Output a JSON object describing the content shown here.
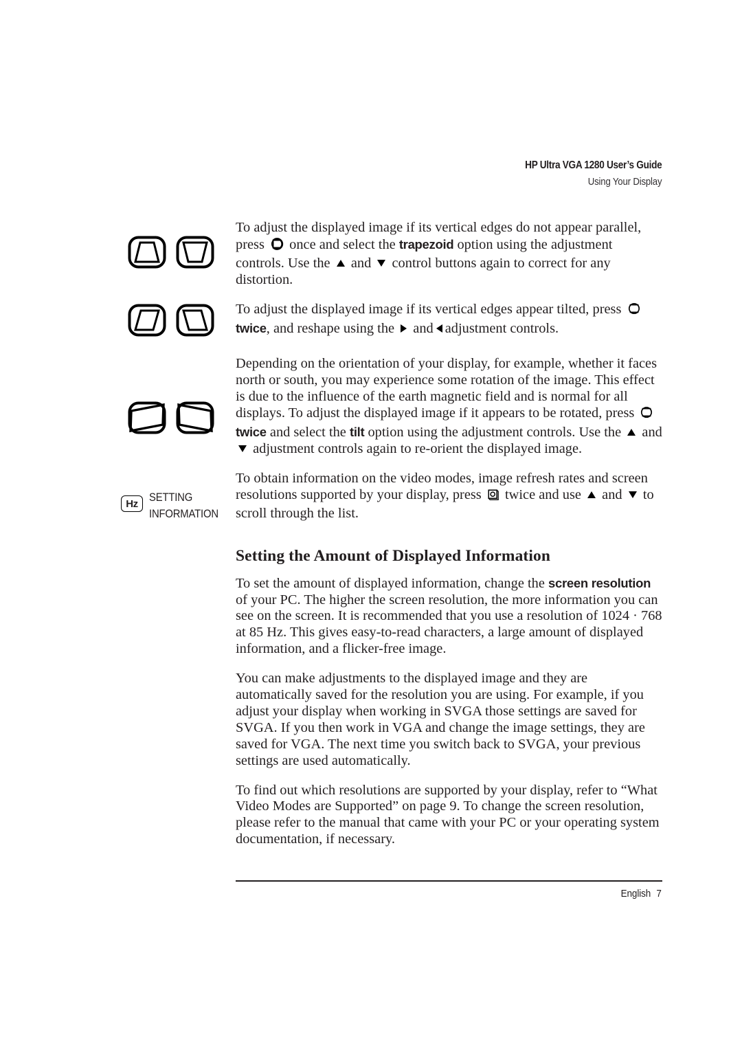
{
  "running_head": {
    "title": "HP Ultra VGA 1280 User’s Guide",
    "subtitle": "Using Your Display"
  },
  "margin_icons": {
    "trapezoid": {
      "name": "trapezoid-adjustment-icons",
      "left_glyph": "trapezoid-narrow-top-icon",
      "right_glyph": "trapezoid-narrow-bottom-icon"
    },
    "parallelogram": {
      "name": "parallelogram-adjustment-icons",
      "left_glyph": "parallelogram-lean-right-icon",
      "right_glyph": "parallelogram-lean-left-icon"
    },
    "rotation": {
      "name": "rotation-adjustment-icons",
      "left_glyph": "rotation-counterclockwise-icon",
      "right_glyph": "rotation-clockwise-icon"
    },
    "setting_information": {
      "badge": "Hz",
      "label_line1": "SETTING",
      "label_line2": "INFORMATION"
    }
  },
  "paragraphs": {
    "trapezoid": {
      "t1": "To adjust the displayed image if its vertical edges do not appear parallel, press",
      "t2": "once and select the",
      "emphasis1": "trapezoid",
      "t3": "option using the adjustment controls. Use the",
      "t4": "and",
      "t5": "control buttons again to correct for any distortion."
    },
    "parallelogram": {
      "t1": "To adjust the displayed image if its vertical edges appear tilted, press",
      "emphasis1": "twice",
      "t2": ", and reshape using the",
      "t3": "and",
      "t4": "adjustment controls."
    },
    "rotation": {
      "t1": "Depending on the orientation of your display, for example, whether it faces north or south, you may experience some rotation of the image. This effect is due to the influence of the earth magnetic field and is normal for all displays. To adjust the displayed image if it appears to be rotated, press",
      "emphasis1": "twice",
      "t2": "and select the",
      "emphasis2": "tilt",
      "t3": "option using the adjustment controls. Use the",
      "t4": "and",
      "t5": "adjustment controls again to re-orient the displayed image."
    },
    "setting_information": {
      "t1": "To obtain information on the video modes, image refresh rates and screen resolutions supported by your display, press",
      "t2": "twice and use",
      "t3": "and",
      "t4": "to scroll through the list."
    }
  },
  "section": {
    "heading": "Setting the Amount of Displayed Information",
    "p1_a": "To set the amount of displayed information, change the",
    "p1_emphasis": "screen resolution",
    "p1_b": "of your PC. The higher the screen resolution, the more information you can see on the screen. It is recommended that you use a resolution of 1024 · 768 at 85 Hz. This gives easy-to-read characters, a large amount of displayed information, and a flicker-free image.",
    "p2": "You can make adjustments to the displayed image and they are automatically saved for the resolution you are using. For example, if you adjust your display when working in SVGA those settings are saved for SVGA. If you then work in VGA and change the image settings, they are saved for VGA. The next time you switch back to SVGA, your previous settings are used automatically.",
    "p3": "To find out which resolutions are supported by your display, refer to “What Video Modes are Supported” on page 9. To change the screen resolution, please refer to the manual that came with your PC or your operating system documentation, if necessary."
  },
  "footer": {
    "language": "English",
    "page_number": "7"
  }
}
